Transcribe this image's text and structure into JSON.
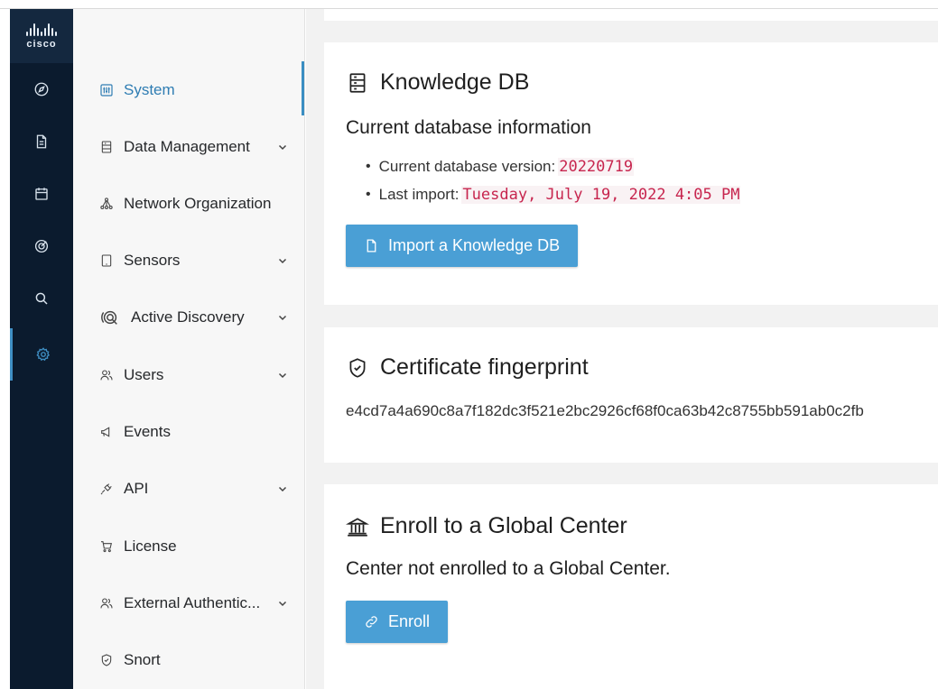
{
  "logo": {
    "text": "cisco"
  },
  "rail": {
    "items": [
      {
        "icon": "compass-icon",
        "name": "explore"
      },
      {
        "icon": "document-icon",
        "name": "reports"
      },
      {
        "icon": "calendar-icon",
        "name": "events"
      },
      {
        "icon": "target-icon",
        "name": "detection"
      },
      {
        "icon": "search-icon",
        "name": "search"
      },
      {
        "icon": "gear-icon",
        "name": "admin",
        "active": true
      }
    ]
  },
  "subnav": {
    "items": [
      {
        "label": "System",
        "icon": "sliders-icon",
        "active": true,
        "expandable": false
      },
      {
        "label": "Data Management",
        "icon": "database-icon",
        "expandable": true
      },
      {
        "label": "Network Organization",
        "icon": "network-icon",
        "expandable": false
      },
      {
        "label": "Sensors",
        "icon": "tablet-icon",
        "expandable": true
      },
      {
        "label": "Active Discovery",
        "icon": "radar-icon",
        "expandable": true
      },
      {
        "label": "Users",
        "icon": "users-icon",
        "expandable": true
      },
      {
        "label": "Events",
        "icon": "megaphone-icon",
        "expandable": false
      },
      {
        "label": "API",
        "icon": "plug-icon",
        "expandable": true
      },
      {
        "label": "License",
        "icon": "cart-icon",
        "expandable": false
      },
      {
        "label": "External Authentic...",
        "icon": "users-icon",
        "expandable": true
      },
      {
        "label": "Snort",
        "icon": "shield-icon",
        "expandable": false
      }
    ]
  },
  "knowledge_db": {
    "title": "Knowledge DB",
    "subheading": "Current database information",
    "version_label": "Current database version:",
    "version_value": "20220719",
    "import_label": "Last import:",
    "import_value": "Tuesday, July 19, 2022 4:05 PM",
    "button_label": "Import a Knowledge DB"
  },
  "certificate": {
    "title": "Certificate fingerprint",
    "fingerprint": "e4cd7a4a690c8a7f182dc3f521e2bc2926cf68f0ca63b42c8755bb591ab0c2fb"
  },
  "global_center": {
    "title": "Enroll to a Global Center",
    "status": "Center not enrolled to a Global Center.",
    "button_label": "Enroll"
  },
  "colors": {
    "rail_bg": "#0b1b2e",
    "accent": "#3a8ec2",
    "button_bg": "#4a9fd5",
    "code_text": "#c7254e"
  }
}
